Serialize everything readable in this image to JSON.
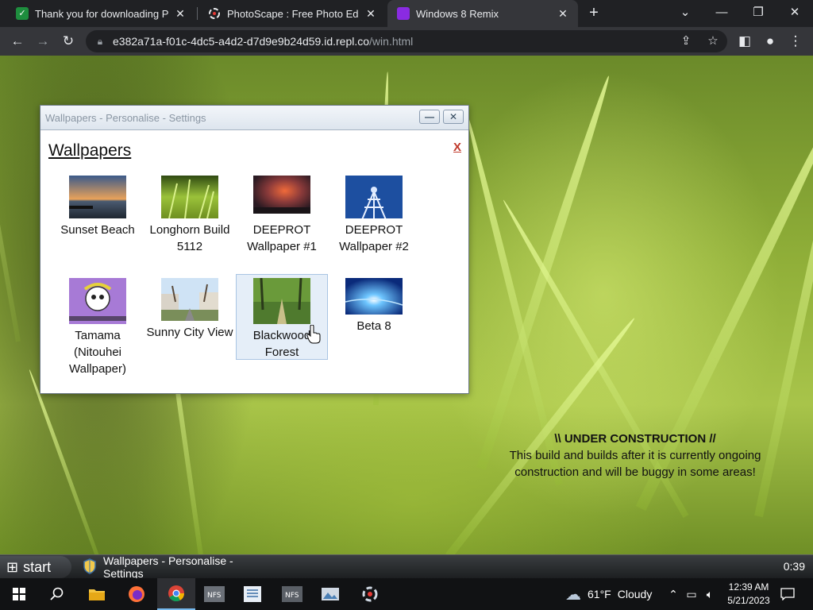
{
  "browser": {
    "tabs": [
      {
        "title": "Thank you for downloading Prim",
        "favicon_color": "#1e8e3e"
      },
      {
        "title": "PhotoScape : Free Photo Editing",
        "favicon_color": "#e8eaed"
      },
      {
        "title": "Windows 8 Remix",
        "favicon_color": "#8a2be2"
      }
    ],
    "new_tab_symbol": "+",
    "url_host": "e382a71a-f01c-4dc5-a4d2-d7d9e9b24d59.id.repl.co",
    "url_path": "/win.html"
  },
  "window": {
    "title": "Wallpapers - Personalise - Settings",
    "minimize_symbol": "—",
    "close_symbol": "✕",
    "heading": "Wallpapers",
    "close_link": "X",
    "wallpapers": [
      {
        "label": "Sunset Beach"
      },
      {
        "label": "Longhorn Build 5112"
      },
      {
        "label": "DEEPROT Wallpaper #1"
      },
      {
        "label": "DEEPROT Wallpaper #2"
      },
      {
        "label": "Tamama (Nitouhei Wallpaper)"
      },
      {
        "label": "Sunny City View"
      },
      {
        "label": "Blackwood Forest",
        "selected": true
      },
      {
        "label": "Beta 8"
      }
    ]
  },
  "notice": {
    "heading": "\\\\ UNDER CONSTRUCTION //",
    "body": "This build and builds after it is currently ongoing construction and will be buggy in some areas!"
  },
  "xp_taskbar": {
    "start_label": "start",
    "task_label": "Wallpapers - Personalise - Settings",
    "clock": "0:39"
  },
  "win10_taskbar": {
    "weather_temp": "61°F",
    "weather_desc": "Cloudy",
    "time": "12:39 AM",
    "date": "5/21/2023"
  },
  "colors": {
    "accent": "#76b9ed",
    "close_link": "#c0392b",
    "selection": "#e5eef8"
  }
}
